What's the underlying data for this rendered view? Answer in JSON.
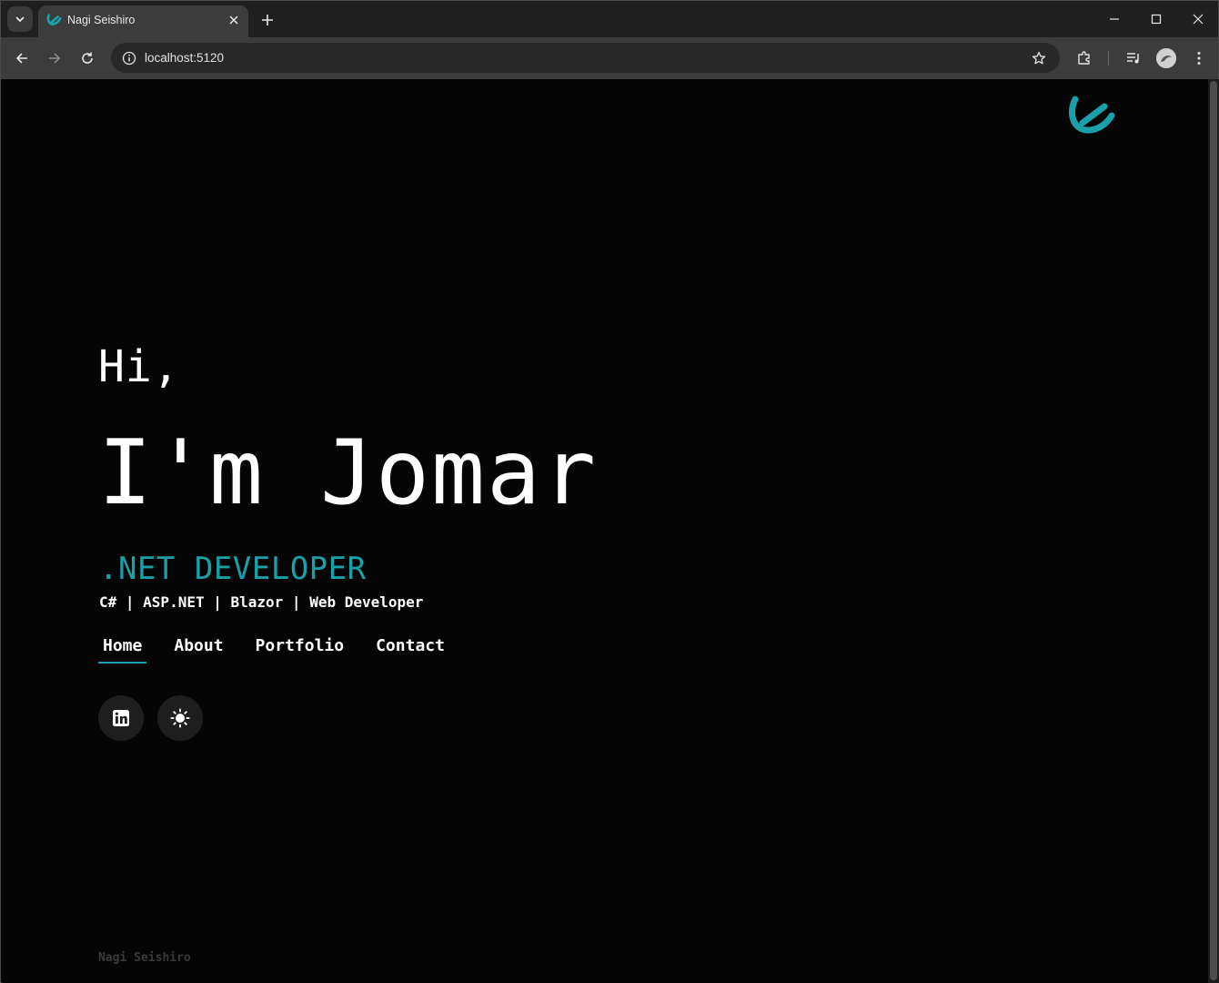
{
  "browser": {
    "tab_title": "Nagi Seishiro",
    "url": "localhost:5120",
    "icons": [
      "tab-search-icon",
      "close-icon",
      "plus-icon",
      "minimize-icon",
      "maximize-icon",
      "window-close-icon",
      "back-arrow-icon",
      "forward-arrow-icon",
      "reload-icon",
      "site-info-icon",
      "star-icon",
      "extensions-icon",
      "media-icon",
      "profile-icon",
      "more-vertical-icon"
    ]
  },
  "hero": {
    "greeting": "Hi,",
    "headline": "I'm Jomar",
    "role": ".NET DEVELOPER",
    "skills": "C# | ASP.NET | Blazor | Web Developer"
  },
  "nav": {
    "items": [
      {
        "label": "Home",
        "active": true
      },
      {
        "label": "About",
        "active": false
      },
      {
        "label": "Portfolio",
        "active": false
      },
      {
        "label": "Contact",
        "active": false
      }
    ]
  },
  "social": {
    "buttons": [
      "linkedin-icon",
      "theme-toggle-sun-icon"
    ]
  },
  "footer": {
    "text": "Nagi Seishiro"
  },
  "colors": {
    "accent": "#19a0a8",
    "background": "#050505",
    "text": "#ffffff",
    "footer_text": "#3a3a3a"
  }
}
